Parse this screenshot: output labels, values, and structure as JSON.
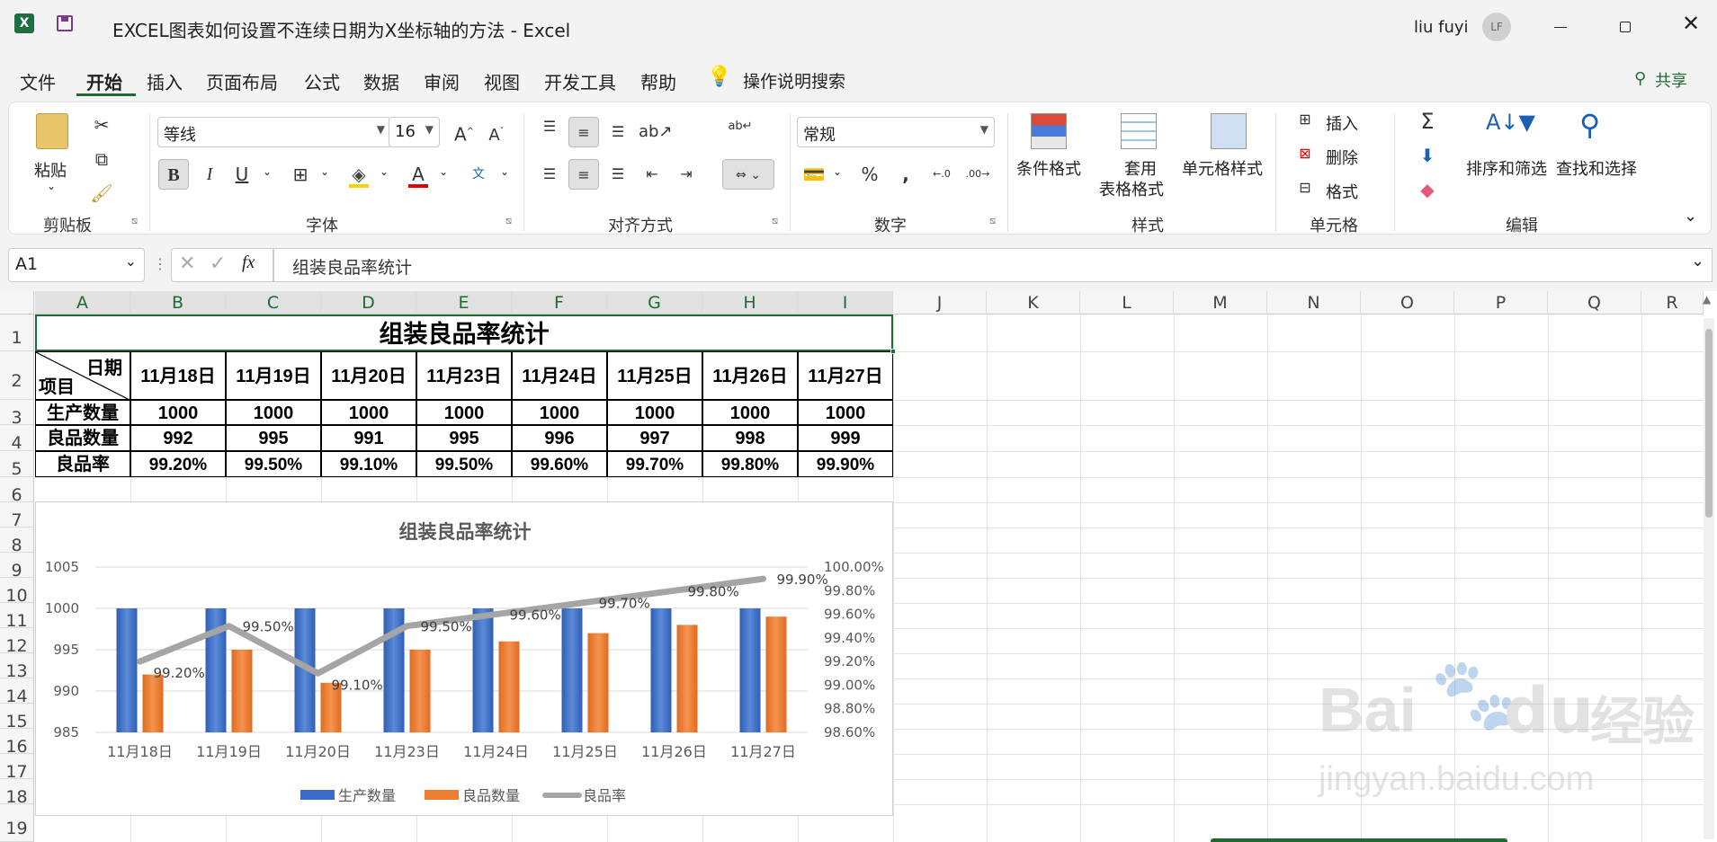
{
  "app": {
    "title": "EXCEL图表如何设置不连续日期为X坐标轴的方法  -  Excel",
    "user": "liu fuyi",
    "initials": "LF"
  },
  "tabs": [
    "文件",
    "开始",
    "插入",
    "页面布局",
    "公式",
    "数据",
    "审阅",
    "视图",
    "开发工具",
    "帮助"
  ],
  "search_label": "操作说明搜索",
  "share_label": "共享",
  "ribbon": {
    "clipboard": {
      "paste": "粘贴",
      "group": "剪贴板"
    },
    "font": {
      "name": "等线",
      "size": "16",
      "bold": "B",
      "italic": "I",
      "underline": "U",
      "group": "字体"
    },
    "align": {
      "group": "对齐方式"
    },
    "number": {
      "format": "常规",
      "group": "数字"
    },
    "styles": {
      "cond": "条件格式",
      "table1": "套用",
      "table2": "表格格式",
      "cell": "单元格样式",
      "group": "样式"
    },
    "cells": {
      "insert": "插入",
      "delete": "删除",
      "format": "格式",
      "group": "单元格"
    },
    "edit": {
      "sort": "排序和筛选",
      "find": "查找和选择",
      "group": "编辑"
    }
  },
  "formula_bar": {
    "name_box": "A1",
    "content": "组装良品率统计"
  },
  "columns": [
    "A",
    "B",
    "C",
    "D",
    "E",
    "F",
    "G",
    "H",
    "I",
    "J",
    "K",
    "L",
    "M",
    "N",
    "O",
    "P",
    "Q",
    "R"
  ],
  "rows": [
    "1",
    "2",
    "3",
    "4",
    "5",
    "6",
    "7",
    "8",
    "9",
    "10",
    "11",
    "12",
    "13",
    "14",
    "15",
    "16",
    "17",
    "18",
    "19"
  ],
  "table": {
    "title": "组装良品率统计",
    "header_date": "日期",
    "header_item": "项目",
    "dates": [
      "11月18日",
      "11月19日",
      "11月20日",
      "11月23日",
      "11月24日",
      "11月25日",
      "11月26日",
      "11月27日"
    ],
    "rows": [
      {
        "label": "生产数量",
        "values": [
          "1000",
          "1000",
          "1000",
          "1000",
          "1000",
          "1000",
          "1000",
          "1000"
        ]
      },
      {
        "label": "良品数量",
        "values": [
          "992",
          "995",
          "991",
          "995",
          "996",
          "997",
          "998",
          "999"
        ]
      },
      {
        "label": "良品率",
        "values": [
          "99.20%",
          "99.50%",
          "99.10%",
          "99.50%",
          "99.60%",
          "99.70%",
          "99.80%",
          "99.90%"
        ]
      }
    ]
  },
  "chart_data": {
    "type": "bar",
    "title": "组装良品率统计",
    "categories": [
      "11月18日",
      "11月19日",
      "11月20日",
      "11月23日",
      "11月24日",
      "11月25日",
      "11月26日",
      "11月27日"
    ],
    "series": [
      {
        "name": "生产数量",
        "type": "bar",
        "axis": "left",
        "values": [
          1000,
          1000,
          1000,
          1000,
          1000,
          1000,
          1000,
          1000
        ],
        "color": "#4472c4"
      },
      {
        "name": "良品数量",
        "type": "bar",
        "axis": "left",
        "values": [
          992,
          995,
          991,
          995,
          996,
          997,
          998,
          999
        ],
        "color": "#ed7d31"
      },
      {
        "name": "良品率",
        "type": "line",
        "axis": "right",
        "values": [
          99.2,
          99.5,
          99.1,
          99.5,
          99.6,
          99.7,
          99.8,
          99.9
        ],
        "color": "#a5a5a5"
      }
    ],
    "data_labels": [
      "99.20%",
      "99.50%",
      "99.10%",
      "99.50%",
      "99.60%",
      "99.70%",
      "99.80%",
      "99.90%"
    ],
    "ylim": [
      985,
      1005
    ],
    "yticks": [
      "985",
      "990",
      "995",
      "1000",
      "1005"
    ],
    "y2lim": [
      98.6,
      100.0
    ],
    "y2ticks": [
      "98.60%",
      "98.80%",
      "99.00%",
      "99.20%",
      "99.40%",
      "99.60%",
      "99.80%",
      "100.00%"
    ],
    "grid": true,
    "legend": "bottom"
  },
  "watermark": {
    "brand": "Bai",
    "brand2": "du",
    "cn": "经验",
    "url": "jingyan.baidu.com"
  }
}
